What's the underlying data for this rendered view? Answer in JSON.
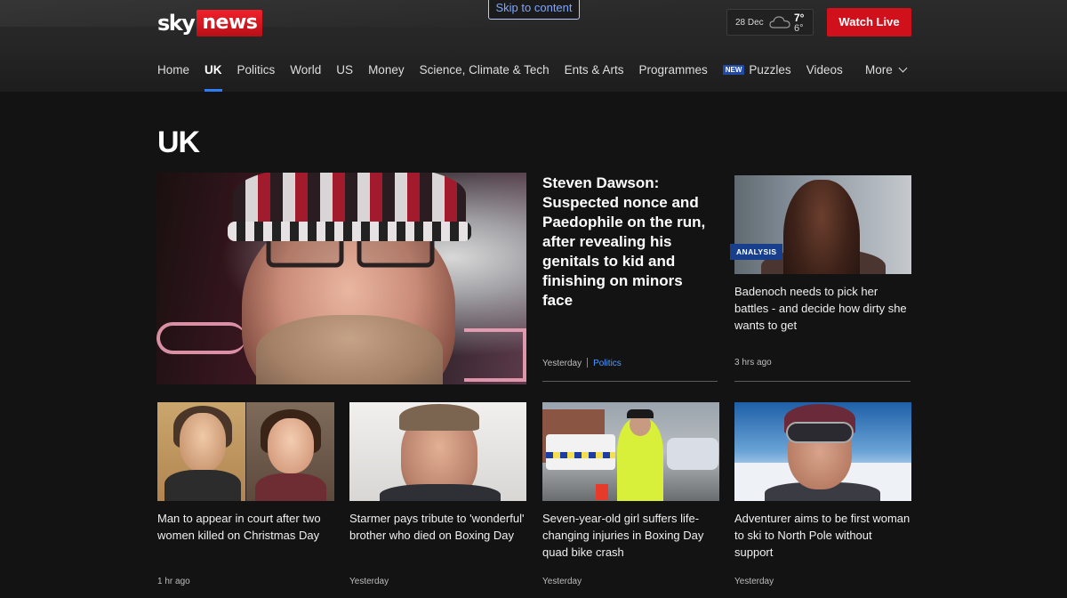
{
  "header": {
    "logo": {
      "sky": "sky",
      "news": "news"
    },
    "skip_link": "Skip to content",
    "weather": {
      "date": "28 Dec",
      "high": "7°",
      "low": "6°",
      "icon": "cloud-icon"
    },
    "watch_live": "Watch Live"
  },
  "nav": {
    "items": [
      "Home",
      "UK",
      "Politics",
      "World",
      "US",
      "Money",
      "Science, Climate & Tech",
      "Ents & Arts",
      "Programmes",
      "Puzzles",
      "Videos"
    ],
    "active": "UK",
    "new_badge": "NEW",
    "more": "More"
  },
  "page": {
    "title": "UK"
  },
  "lead": {
    "headline": "Steven Dawson: Suspected nonce and Paedophile on the run, after revealing his genitals to kid and finishing on minors face",
    "time": "Yesterday",
    "tag": "Politics"
  },
  "side": {
    "badge": "ANALYSIS",
    "headline": "Badenoch needs to pick her battles - and decide how dirty she wants to get",
    "time": "3 hrs ago"
  },
  "cards": [
    {
      "headline": "Man to appear in court after two women killed on Christmas Day",
      "time": "1 hr ago"
    },
    {
      "headline": "Starmer pays tribute to 'wonderful' brother who died on Boxing Day",
      "time": "Yesterday"
    },
    {
      "headline": "Seven-year-old girl suffers life-changing injuries in Boxing Day quad bike crash",
      "time": "Yesterday"
    },
    {
      "headline": "Adventurer aims to be first woman to ski to North Pole without support",
      "time": "Yesterday"
    }
  ],
  "colors": {
    "accent": "#d0111b",
    "active_underline": "#2e7cf6",
    "analysis_badge": "#173f8c",
    "tag_link": "#4f9bff"
  }
}
